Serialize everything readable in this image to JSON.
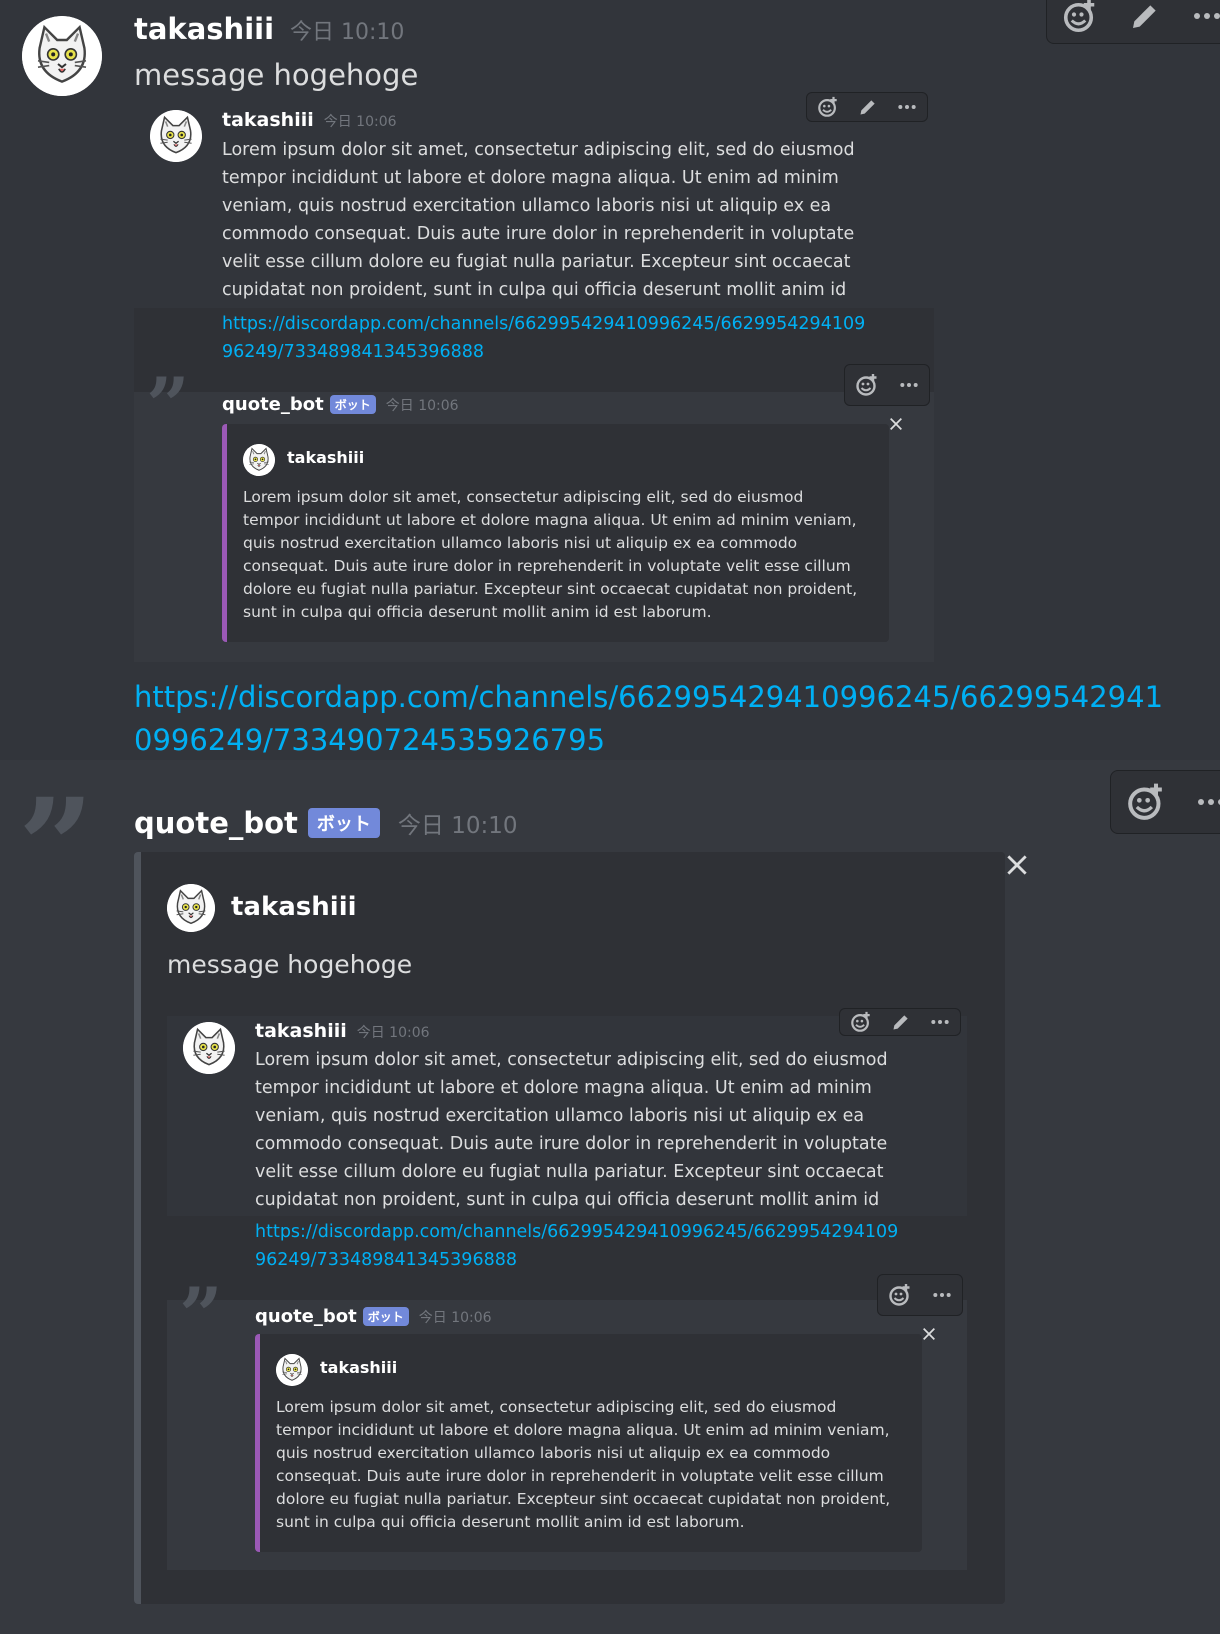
{
  "colors": {
    "background": "#36393f",
    "embed_bg": "#2f3136",
    "link": "#00b0f4",
    "bot_badge": "#7289da",
    "quote_border_purple": "#9b59b6",
    "outer_embed_border": "#4f545c"
  },
  "icons": [
    "add-reaction-icon",
    "edit-icon",
    "more-icon",
    "close-icon",
    "quote-icon",
    "cat-avatar-icon"
  ],
  "message1": {
    "author": "takashiii",
    "timestamp": "今日 10:10",
    "content": "message hogehoge",
    "link": "https://discordapp.com/channels/662995429410996245/662995429410996249/733490724535926795"
  },
  "screenshot": {
    "author": "takashiii",
    "timestamp": "今日 10:06",
    "lorem": "Lorem ipsum dolor sit amet, consectetur adipiscing elit, sed do eiusmod tempor incididunt ut labore et dolore magna aliqua. Ut enim ad minim veniam, quis nostrud exercitation ullamco laboris nisi ut aliquip ex ea commodo consequat. Duis aute irure dolor in reprehenderit in voluptate velit esse cillum dolore eu fugiat nulla pariatur. Excepteur sint occaecat cupidatat non proident, sunt in culpa qui officia deserunt mollit anim id est laborum.",
    "link": "https://discordapp.com/channels/662995429410996245/662995429410996249/733489841345396888",
    "bot_name": "quote_bot",
    "bot_badge": "ボット",
    "bot_timestamp": "今日 10:06",
    "embed_author": "takashiii"
  },
  "message2": {
    "author": "quote_bot",
    "badge": "ボット",
    "timestamp": "今日 10:10",
    "embed_author": "takashiii",
    "embed_text": "message hogehoge"
  }
}
